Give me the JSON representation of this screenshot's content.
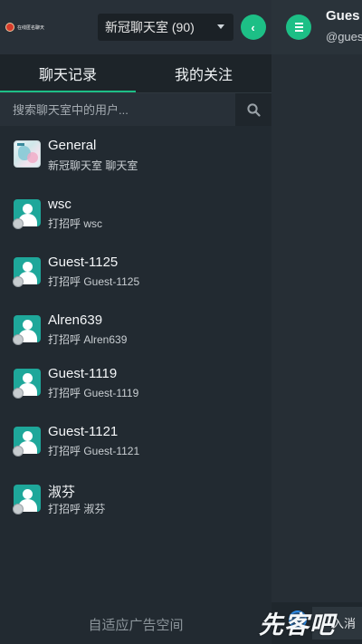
{
  "header": {
    "logo_text": "在线匿名聊天",
    "room_select": "新冠聊天室 (90)",
    "collapse_icon": "chevron-left-icon"
  },
  "tabs": [
    {
      "label": "聊天记录",
      "active": true
    },
    {
      "label": "我的关注",
      "active": false
    }
  ],
  "search": {
    "placeholder": "搜索聊天室中的用户...",
    "icon": "search-icon"
  },
  "chats": [
    {
      "name": "General",
      "subtitle": "新冠聊天室 聊天室",
      "avatar": "room-avatar"
    },
    {
      "name": "wsc",
      "subtitle": "打招呼 wsc",
      "avatar": "user-avatar"
    },
    {
      "name": "Guest-1125",
      "subtitle": "打招呼 Guest-1125",
      "avatar": "user-avatar"
    },
    {
      "name": "Alren639",
      "subtitle": "打招呼 Alren639",
      "avatar": "user-avatar"
    },
    {
      "name": "Guest-1119",
      "subtitle": "打招呼 Guest-1119",
      "avatar": "user-avatar"
    },
    {
      "name": "Guest-1121",
      "subtitle": "打招呼 Guest-1121",
      "avatar": "user-avatar"
    },
    {
      "name": "淑芬",
      "subtitle": "打招呼 淑芬",
      "avatar": "user-avatar"
    }
  ],
  "ad_text": "自适应广告空间",
  "conversation": {
    "peer_name": "Gues",
    "peer_id": "@gues",
    "compose_placeholder": "入消",
    "menu_icon": "menu-icon"
  },
  "watermark": "先客吧",
  "colors": {
    "accent": "#1dbf86",
    "avatar_bg": "#1ea79a",
    "panel_bg": "#222a31"
  }
}
